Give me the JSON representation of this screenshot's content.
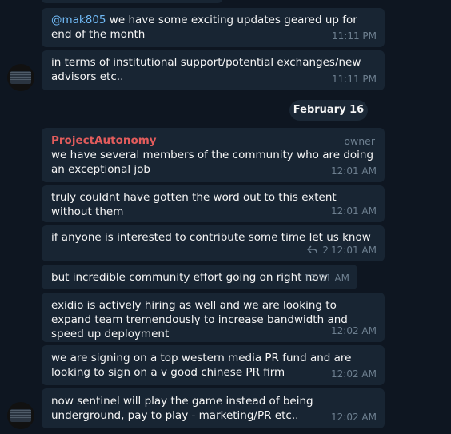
{
  "messages": [
    {
      "mention": "@mak805",
      "text": " we have some exciting updates geared up for end of the month",
      "time": "11:11 PM"
    },
    {
      "text": "in terms of institutional support/potential exchanges/new advisors etc..",
      "time": "11:11 PM"
    },
    {
      "sender": "ProjectAutonomy",
      "badge": "owner",
      "text": "we have several members of the community who are doing an exceptional job",
      "time": "12:01 AM"
    },
    {
      "text": "truly couldnt have gotten the word out to this extent without them",
      "time": "12:01 AM"
    },
    {
      "text": "if anyone is interested to contribute some time let us know",
      "replies": "2",
      "time": "12:01 AM"
    },
    {
      "text": "but incredible community effort going on right now",
      "time": "12:01 AM"
    },
    {
      "text": "exidio is actively hiring as well and we are looking to expand team tremendously to increase bandwidth and speed up deployment",
      "time": "12:02 AM"
    },
    {
      "text": "we are signing on a top western media PR fund and are looking to sign on a v good chinese PR firm",
      "time": "12:02 AM"
    },
    {
      "text": "now sentinel will play the game instead of being underground, pay to play - marketing/PR etc..",
      "time": "12:02 AM"
    }
  ],
  "date_separator": "February 16",
  "colors": {
    "background": "#0e1621",
    "bubble": "#182533",
    "sender": "#e25c5c",
    "mention": "#71baf6",
    "meta": "#6d7f8f"
  }
}
